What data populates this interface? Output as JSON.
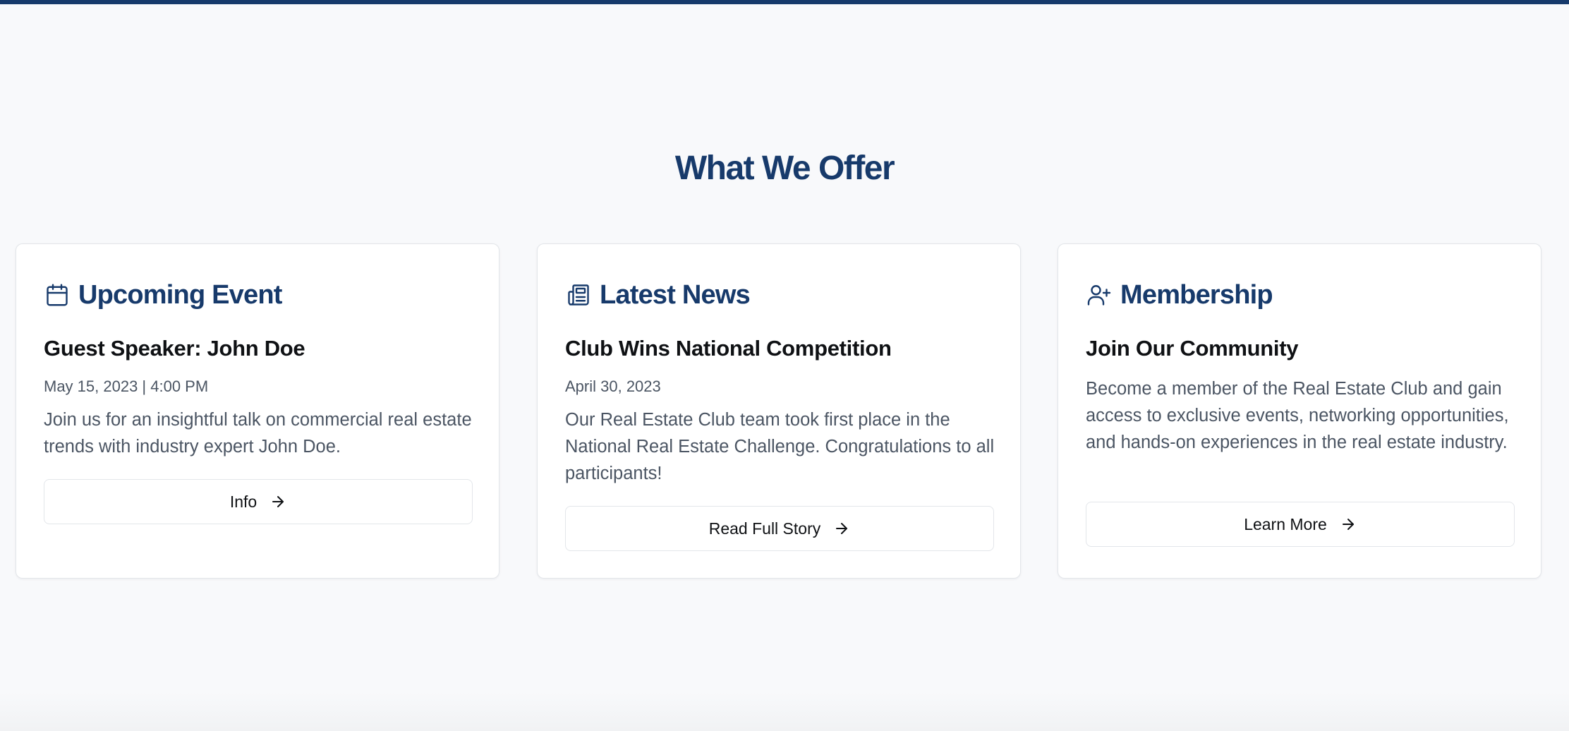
{
  "section": {
    "title": "What We Offer"
  },
  "cards": [
    {
      "heading": "Upcoming Event",
      "icon": "calendar-icon",
      "item_title": "Guest Speaker: John Doe",
      "meta": "May 15, 2023 | 4:00 PM",
      "description": "Join us for an insightful talk on commercial real estate trends with industry expert John Doe.",
      "button_label": "Info"
    },
    {
      "heading": "Latest News",
      "icon": "newspaper-icon",
      "item_title": "Club Wins National Competition",
      "meta": "April 30, 2023",
      "description": "Our Real Estate Club team took first place in the National Real Estate Challenge. Congratulations to all participants!",
      "button_label": "Read Full Story"
    },
    {
      "heading": "Membership",
      "icon": "user-plus-icon",
      "item_title": "Join Our Community",
      "description": "Become a member of the Real Estate Club and gain access to exclusive events, networking opportunities, and hands-on experiences in the real estate industry.",
      "button_label": "Learn More"
    }
  ],
  "colors": {
    "accent": "#173a6b",
    "top_bar": "#163a6b",
    "background": "#f8f9fb",
    "card_border": "#e3e6ea",
    "body_text": "#4b5563"
  }
}
